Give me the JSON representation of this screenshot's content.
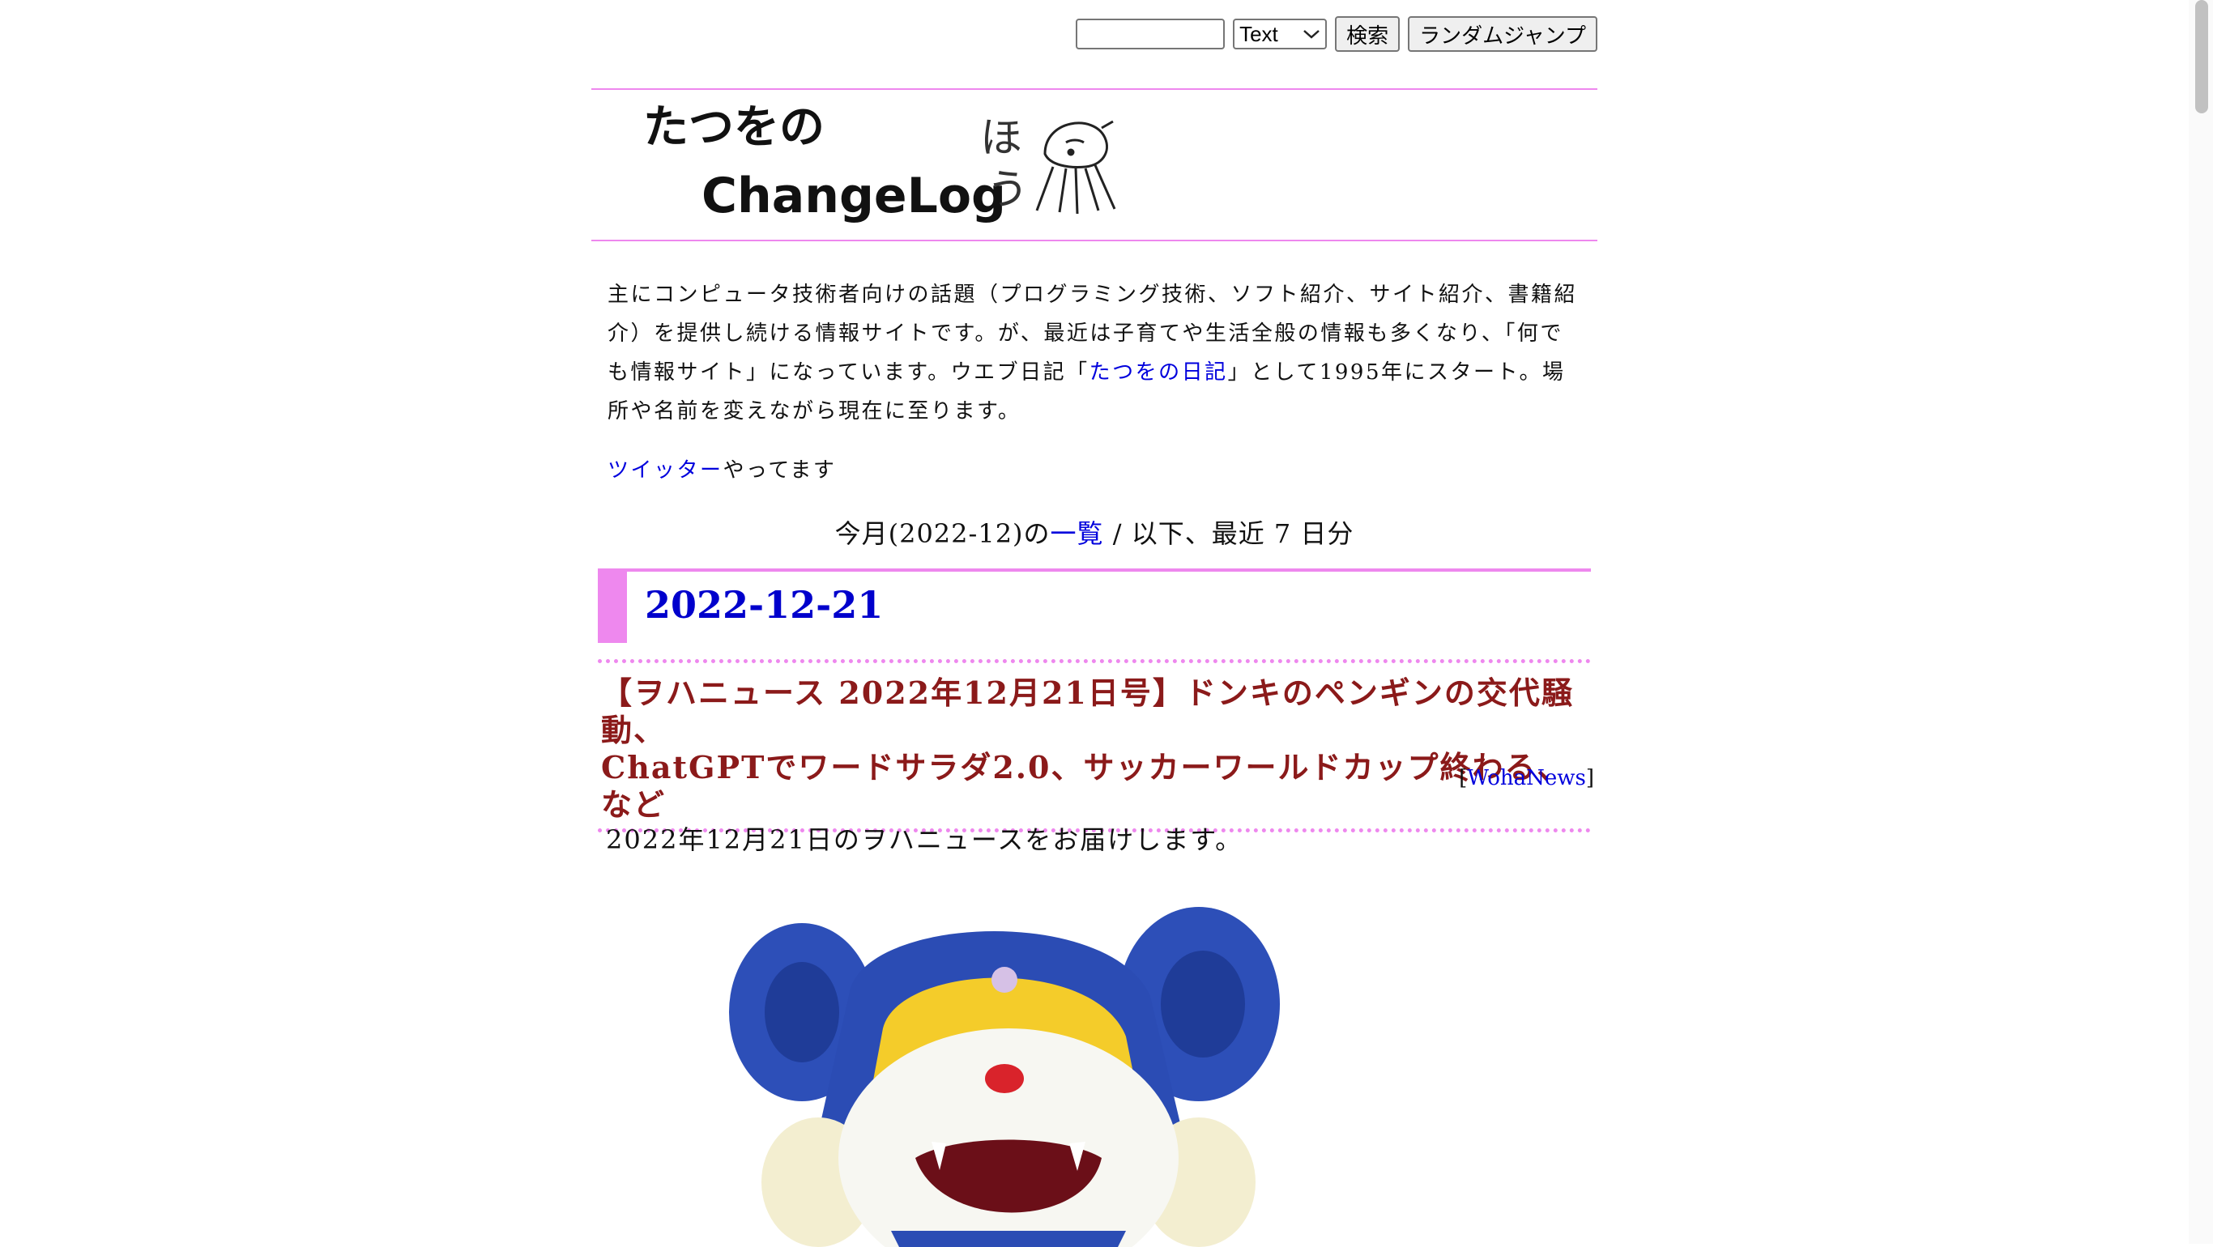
{
  "search": {
    "placeholder": "",
    "value": "",
    "mode_selected": "Text",
    "search_button": "検索",
    "random_button": "ランダムジャンプ"
  },
  "header": {
    "logo_line1": "たつをの",
    "logo_line2": "ChangeLog",
    "logo_hand_text1": "ほ",
    "logo_hand_text2": "う"
  },
  "intro": {
    "part1": "主にコンピュータ技術者向けの話題（プログラミング技術、ソフト紹介、サイト紹介、書籍紹介）を提供し続ける情報サイトです。が、最近は子育てや生活全般の情報も多くなり、「何でも情報サイト」になっています。ウエブ日記「",
    "diary_link": "たつをの日記",
    "part2": "」として1995年にスタート。場所や名前を変えながら現在に至ります。",
    "twitter_link": "ツイッター",
    "twitter_suffix": "やってます"
  },
  "month_nav": {
    "prefix": "今月(2022-12)の",
    "list_link": "一覧",
    "suffix": " / 以下、最近 7 日分"
  },
  "day": {
    "date": "2022-12-21"
  },
  "article": {
    "title_line1": "【ヲハニュース 2022年12月21日号】ドンキのペンギンの交代騒動、",
    "title_line2": "ChatGPTでワードサラダ2.0、サッカーワールドカップ終わる、など",
    "category_open": "[",
    "category": "WohaNews",
    "category_close": "]",
    "body": "2022年12月21日のヲハニュースをお届けします。"
  },
  "colors": {
    "accent_pink": "#ee88ee",
    "link_blue": "#0000dd",
    "title_red": "#8b1a1a"
  }
}
